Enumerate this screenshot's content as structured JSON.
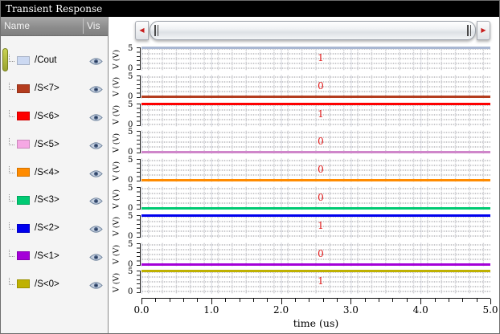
{
  "window": {
    "title": "Transient Response"
  },
  "panel": {
    "name_header": "Name",
    "vis_header": "Vis"
  },
  "icons": {
    "scroll_left_arrow": "◀",
    "scroll_right_arrow": "▶",
    "eye": "eye-icon"
  },
  "colors": {
    "value_annotation": "#e01818",
    "selection_indicator": "#aab33c"
  },
  "signals": [
    {
      "name": "/Cout",
      "swatch_color": "#ccd9f2",
      "trace_color": "#a9b7d2",
      "level": "high",
      "voltage": 5,
      "value": "1",
      "visible": true,
      "selected": true
    },
    {
      "name": "/S<7>",
      "swatch_color": "#b43c1e",
      "trace_color": "#b43c1e",
      "level": "low",
      "voltage": 0,
      "value": "0",
      "visible": true,
      "selected": false
    },
    {
      "name": "/S<6>",
      "swatch_color": "#fe0000",
      "trace_color": "#fe0000",
      "level": "high",
      "voltage": 5,
      "value": "1",
      "visible": true,
      "selected": false
    },
    {
      "name": "/S<5>",
      "swatch_color": "#f6a8e4",
      "trace_color": "#cf86ca",
      "level": "low",
      "voltage": 0,
      "value": "0",
      "visible": true,
      "selected": false
    },
    {
      "name": "/S<4>",
      "swatch_color": "#ff8b00",
      "trace_color": "#ff8b00",
      "level": "low",
      "voltage": 0,
      "value": "0",
      "visible": true,
      "selected": false
    },
    {
      "name": "/S<3>",
      "swatch_color": "#00ca73",
      "trace_color": "#00ca73",
      "level": "low",
      "voltage": 0,
      "value": "0",
      "visible": true,
      "selected": false
    },
    {
      "name": "/S<2>",
      "swatch_color": "#0000ee",
      "trace_color": "#0000ee",
      "level": "high",
      "voltage": 5,
      "value": "1",
      "visible": true,
      "selected": false
    },
    {
      "name": "/S<1>",
      "swatch_color": "#a400d8",
      "trace_color": "#a400d8",
      "level": "low",
      "voltage": 0,
      "value": "0",
      "visible": true,
      "selected": false
    },
    {
      "name": "/S<0>",
      "swatch_color": "#bfb100",
      "trace_color": "#bfb100",
      "level": "high",
      "voltage": 5,
      "value": "1",
      "visible": true,
      "selected": false
    }
  ],
  "axis": {
    "y_top": "5",
    "y_bottom": "0",
    "y_label": "V (V)",
    "x_ticks": [
      "0.0",
      "1.0",
      "2.0",
      "3.0",
      "4.0",
      "5.0"
    ],
    "x_label": "time (us)",
    "x_range_us": [
      0,
      5
    ],
    "y_range_v": [
      0,
      5
    ]
  }
}
